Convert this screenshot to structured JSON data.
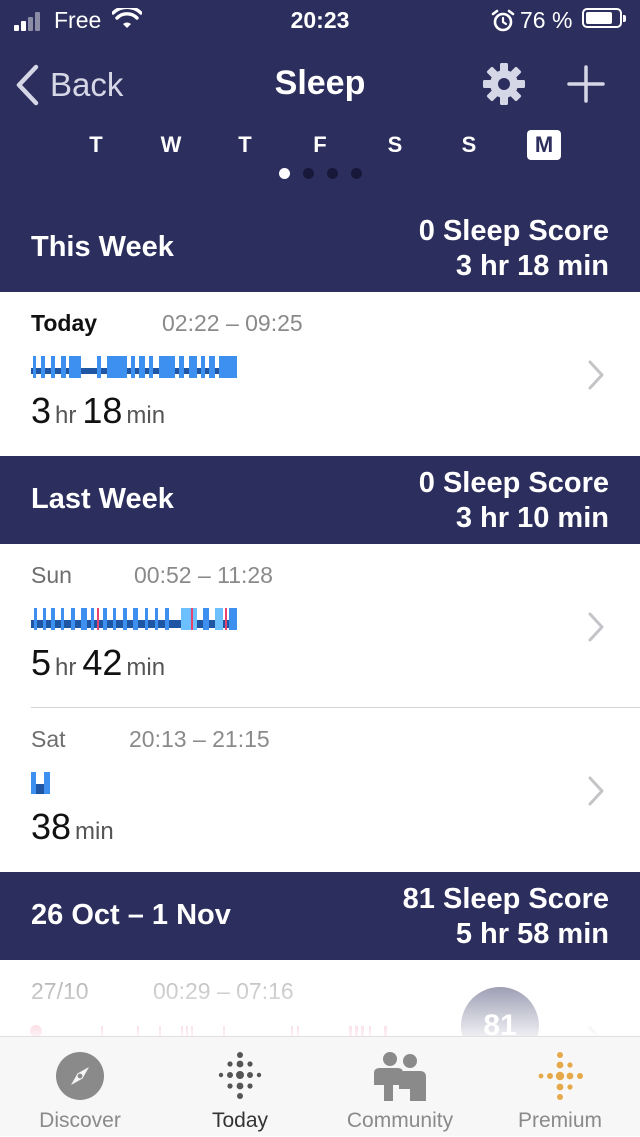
{
  "status": {
    "carrier": "Free",
    "time": "20:23",
    "battery": "76 %"
  },
  "nav": {
    "back_label": "Back",
    "title": "Sleep"
  },
  "days": [
    "T",
    "W",
    "T",
    "F",
    "S",
    "S",
    "M"
  ],
  "selected_day_index": 6,
  "page_dots": {
    "count": 4,
    "active": 0
  },
  "this_week": {
    "title": "This Week",
    "score": "0 Sleep Score",
    "duration": "3 hr 18 min",
    "entries": [
      {
        "day": "Today",
        "range": "02:22 – 09:25",
        "dur_parts": [
          {
            "n": "3",
            "u": "hr"
          },
          {
            "n": "18",
            "u": "min"
          }
        ]
      }
    ]
  },
  "last_week": {
    "title": "Last Week",
    "score": "0 Sleep Score",
    "duration": "3 hr 10 min",
    "entries": [
      {
        "day": "Sun",
        "range": "00:52 – 11:28",
        "dur_parts": [
          {
            "n": "5",
            "u": "hr"
          },
          {
            "n": "42",
            "u": "min"
          }
        ]
      },
      {
        "day": "Sat",
        "range": "20:13 – 21:15",
        "dur_parts": [
          {
            "n": "38",
            "u": "min"
          }
        ]
      }
    ]
  },
  "older_week": {
    "title": "26 Oct – 1 Nov",
    "score": "81 Sleep Score",
    "duration": "5 hr 58 min",
    "entries": [
      {
        "day": "27/10",
        "range": "00:29 – 07:16",
        "score_badge": "81"
      }
    ]
  },
  "tabs": [
    {
      "label": "Discover",
      "icon": "compass-icon",
      "active": false
    },
    {
      "label": "Today",
      "icon": "fitbit-dots-icon",
      "active": true
    },
    {
      "label": "Community",
      "icon": "community-people-icon",
      "active": false
    },
    {
      "label": "Premium",
      "icon": "premium-dots-icon",
      "active": false
    }
  ],
  "colors": {
    "header_bg": "#2c2e5d",
    "sleep_deep": "#1f56a3",
    "sleep_light": "#3d8ff0",
    "sleep_rem": "#6cc0ff",
    "sleep_awake": "#e8436e",
    "premium_accent": "#e6a94a"
  }
}
